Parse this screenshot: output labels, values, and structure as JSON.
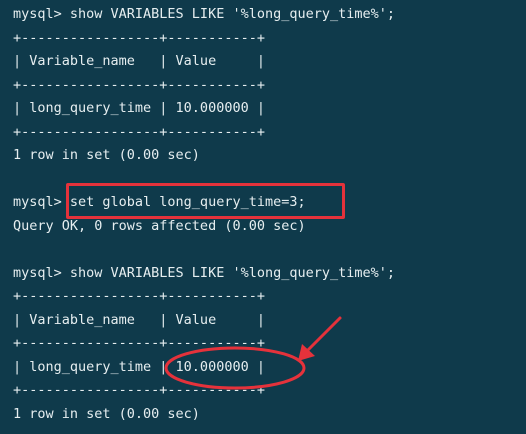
{
  "terminal": {
    "lines": [
      "mysql> show VARIABLES LIKE '%long_query_time%';",
      "+-----------------+-----------+",
      "| Variable_name   | Value     |",
      "+-----------------+-----------+",
      "| long_query_time | 10.000000 |",
      "+-----------------+-----------+",
      "1 row in set (0.00 sec)",
      "",
      "mysql> set global long_query_time=3;",
      "Query OK, 0 rows affected (0.00 sec)",
      "",
      "mysql> show VARIABLES LIKE '%long_query_time%';",
      "+-----------------+-----------+",
      "| Variable_name   | Value     |",
      "+-----------------+-----------+",
      "| long_query_time | 10.000000 |",
      "+-----------------+-----------+",
      "1 row in set (0.00 sec)"
    ]
  },
  "colors": {
    "background": "#0f3a4b",
    "text": "#e6eef0",
    "annotation": "#e5323b"
  }
}
